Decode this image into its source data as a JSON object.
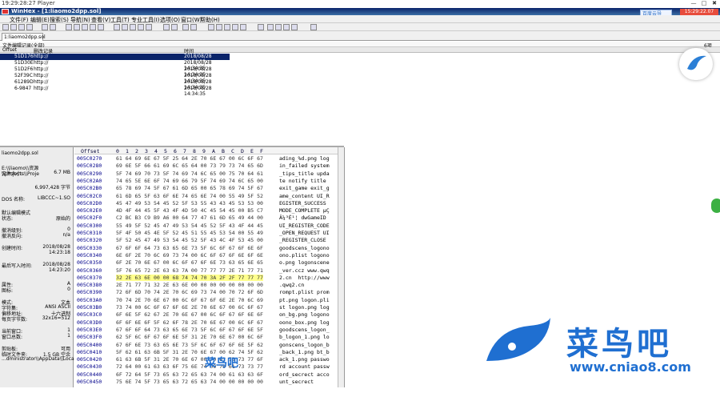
{
  "player": {
    "title": "19:29:28:27 Player",
    "controls": [
      "—",
      "□",
      "✖"
    ]
  },
  "window": {
    "title": "WinHex - [1:liaomo2dpp.sol]"
  },
  "recorder": {
    "label": "15:29:22.07"
  },
  "baidu": {
    "label": "百度云导"
  },
  "menus": [
    "文件(F)",
    "编辑(E)",
    "搜索(S)",
    "导航(N)",
    "查看(V)",
    "工具(T)",
    "专业工具(I)",
    "选项(O)",
    "窗口(W)",
    "帮助(H)"
  ],
  "tab": {
    "label": "1:liaomo2dpp.sol"
  },
  "top_strip": {
    "left": "文件编辑记录(全部)",
    "right": "6项"
  },
  "list_header": {
    "col1": "Offset",
    "col2": "删改记录",
    "col3": "时间"
  },
  "list_rows": [
    {
      "offset": "51D176",
      "desc": "http://",
      "time": "2018/08/28 14:34:35",
      "selected": true
    },
    {
      "offset": "51D30E",
      "desc": "http://",
      "time": "2018/08/28 14:34:35",
      "selected": false
    },
    {
      "offset": "51D2F6",
      "desc": "http://",
      "time": "2018/08/28 14:34:35",
      "selected": false
    },
    {
      "offset": "52F39C",
      "desc": "http://",
      "time": "2018/08/28 14:34:35",
      "selected": false
    },
    {
      "offset": "61289D",
      "desc": "http://",
      "time": "2018/08/28 14:34:35",
      "selected": false
    },
    {
      "offset": "6-9847",
      "desc": "http://",
      "time": "2018/08/28 14:34:35",
      "selected": false
    }
  ],
  "info": [
    {
      "k": "liaomo2dpp.sol",
      "v": ""
    },
    {
      "k": "E:\\\\liaomo\\\\资源\\\\projects\\\\Proje",
      "v": ""
    },
    {
      "k": "文件大小:",
      "v": "6.7 MB"
    },
    {
      "k": "",
      "v": "6,997,428 字节"
    },
    {
      "k": "DOS 名称:",
      "v": "LIBCCC~1.SO"
    },
    {
      "k": "默认编辑模式",
      "v": ""
    },
    {
      "k": "状态:",
      "v": "原始的"
    },
    {
      "k": "撤消级别:",
      "v": "0"
    },
    {
      "k": "撤消反向:",
      "v": "n/a"
    },
    {
      "k": "创建时间:",
      "v": "2018/08/28"
    },
    {
      "k": "",
      "v": "14:23:18"
    },
    {
      "k": "最后写入时间:",
      "v": "2018/08/28"
    },
    {
      "k": "",
      "v": "14:23:20"
    },
    {
      "k": "属性:",
      "v": "A"
    },
    {
      "k": "图标:",
      "v": "0"
    },
    {
      "k": "模式:",
      "v": "文本"
    },
    {
      "k": "字符集:",
      "v": "ANSI ASCII"
    },
    {
      "k": "偏移地址:",
      "v": "十六进制"
    },
    {
      "k": "每页字节数:",
      "v": "32x16=512"
    },
    {
      "k": "当前窗口:",
      "v": "1"
    },
    {
      "k": "窗口总数:",
      "v": "1"
    },
    {
      "k": "剪贴板:",
      "v": "可用"
    },
    {
      "k": "临时文件夹:",
      "v": "1.5 GB 空余"
    },
    {
      "k": "...dministrator\\\\AppData\\\\Local\\\\Temp",
      "v": ""
    }
  ],
  "hex_header": {
    "offset": "Offset",
    "cols": [
      "0",
      "1",
      "2",
      "3",
      "4",
      "5",
      "6",
      "7",
      "8",
      "9",
      "A",
      "B",
      "C",
      "D",
      "E",
      "F"
    ]
  },
  "hex_rows": [
    {
      "off": "005C0270",
      "hex": "61 64 69 6E 67 5F 25 64 2E 70 6E 67 00 6C 6F 67",
      "txt": "ading_%d.png log"
    },
    {
      "off": "005C0280",
      "hex": "69 6E 5F 66 61 69 6C 65 64 00 73 79 73 74 65 6D",
      "txt": "in_failed system"
    },
    {
      "off": "005C0290",
      "hex": "5F 74 69 70 73 5F 74 69 74 6C 65 00 75 70 64 61",
      "txt": "_tips_title upda"
    },
    {
      "off": "005C02A0",
      "hex": "74 65 5E 6E 6F 74 69 66 79 5F 74 69 74 6C 65 00",
      "txt": "te notify title "
    },
    {
      "off": "005C02B0",
      "hex": "65 78 69 74 5F 67 61 6D 65 00 65 78 69 74 5F 67",
      "txt": "exit_game exit_g"
    },
    {
      "off": "005C02C0",
      "hex": "61 6D 65 5F 63 6F 6E 74 65 6E 74 00 55 49 5F 52",
      "txt": "ame_content UI_R"
    },
    {
      "off": "005C02D0",
      "hex": "45 47 49 53 54 45 52 5F 53 55 43 43 45 53 53 00",
      "txt": "EGISTER_SUCCESS "
    },
    {
      "off": "005C02E0",
      "hex": "4D 4F 44 45 5F 43 4F 4D 50 4C 45 54 45 00 B5 C7",
      "txt": "MODE_COMPLETE µÇ"
    },
    {
      "off": "005C02F0",
      "hex": "C2 BC B3 C9 B9 A6 00 64 77 47 61 6D 65 49 44 00",
      "txt": "Â¼³É¹¦ dwGameID "
    },
    {
      "off": "005C0300",
      "hex": "55 49 5F 52 45 47 49 53 54 45 52 5F 43 4F 44 45",
      "txt": "UI_REGISTER_CODE"
    },
    {
      "off": "005C0310",
      "hex": "5F 4F 50 45 4E 5F 52 45 51 55 45 53 54 00 55 49",
      "txt": "_OPEN_REQUEST UI"
    },
    {
      "off": "005C0320",
      "hex": "5F 52 45 47 49 53 54 45 52 5F 43 4C 4F 53 45 00",
      "txt": "_REGISTER_CLOSE "
    },
    {
      "off": "005C0330",
      "hex": "67 6F 6F 64 73 63 65 6E 73 5F 6C 6F 67 6F 6E 6F",
      "txt": "goodscens_logono"
    },
    {
      "off": "005C0340",
      "hex": "6E 6F 2E 70 6C 69 73 74 00 6C 6F 67 6F 6E 6F 6E",
      "txt": "ono.plist logono"
    },
    {
      "off": "005C0350",
      "hex": "6F 2E 70 6E 67 00 6C 6F 67 6F 6E 73 63 65 6E 65",
      "txt": "o.png logonscene"
    },
    {
      "off": "005C0360",
      "hex": "5F 76 65 72 2E 63 63 7A 00 77 77 77 2E 71 77 71",
      "txt": "_ver.ccz www.qwq"
    },
    {
      "off": "005C0370",
      "hex": "32 2E 63 6E 00 00 68 74 74 70 3A 2F 2F 77 77 77",
      "txt": "2.cn  http://www",
      "hl": true
    },
    {
      "off": "005C0380",
      "hex": "2E 71 77 71 32 2E 63 6E 00 00 00 00 00 00 00 00",
      "txt": ".qwq2.cn        "
    },
    {
      "off": "005C0390",
      "hex": "72 6F 6D 70 74 2E 70 6C 69 73 74 00 70 72 6F 6D",
      "txt": "rompt.plist prom"
    },
    {
      "off": "005C03A0",
      "hex": "70 74 2E 70 6E 67 00 6C 6F 67 6F 6E 2E 70 6C 69",
      "txt": "pt.png logon.pli"
    },
    {
      "off": "005C03B0",
      "hex": "73 74 00 6C 6F 67 6F 6E 2E 70 6E 67 00 6C 6F 67",
      "txt": "st logon.png log"
    },
    {
      "off": "005C03C0",
      "hex": "6F 6E 5F 62 67 2E 70 6E 67 00 6C 6F 67 6F 6E 6F",
      "txt": "on_bg.png logono"
    },
    {
      "off": "005C03D0",
      "hex": "6F 6F 6E 6F 5F 62 6F 78 2E 70 6E 67 00 6C 6F 67",
      "txt": "oono_box.png log"
    },
    {
      "off": "005C03E0",
      "hex": "67 6F 6F 64 73 63 65 6E 73 5F 6C 6F 67 6F 6E 5F",
      "txt": "goodscens_logon_"
    },
    {
      "off": "005C03F0",
      "hex": "62 5F 6C 6F 67 6F 6E 5F 31 2E 70 6E 67 00 6C 6F",
      "txt": "b_logon_1.png lo"
    },
    {
      "off": "005C0400",
      "hex": "67 6F 6E 73 63 65 6E 73 5F 6C 6F 67 6F 6E 5F 62",
      "txt": "gonscens_logon_b"
    },
    {
      "off": "005C0410",
      "hex": "5F 62 61 63 6B 5F 31 2E 70 6E 67 00 62 74 5F 62",
      "txt": "_back_1.png bt_b"
    },
    {
      "off": "005C0420",
      "hex": "61 63 6B 5F 31 2E 70 6E 67 00 70 61 73 73 77 6F",
      "txt": "ack_1.png passwo"
    },
    {
      "off": "005C0430",
      "hex": "72 64 00 61 63 63 6F 75 6E 74 00 70 61 73 73 77",
      "txt": "rd account passw"
    },
    {
      "off": "005C0440",
      "hex": "6F 72 64 5F 73 65 63 72 65 63 74 00 61 63 63 6F",
      "txt": "ord_secrect acco"
    },
    {
      "off": "005C0450",
      "hex": "75 6E 74 5F 73 65 63 72 65 63 74 00 00 00 00 00",
      "txt": "unt_secrect     "
    }
  ],
  "watermark": {
    "brand_cn": "菜鸟吧",
    "url": "www.cniao8.com",
    "small": "菜鸟吧"
  },
  "colors": {
    "title_blue": "#0a246a",
    "select_blue": "#0a246a",
    "highlight": "#ffff8c",
    "brand_blue": "#1f6fd1"
  }
}
